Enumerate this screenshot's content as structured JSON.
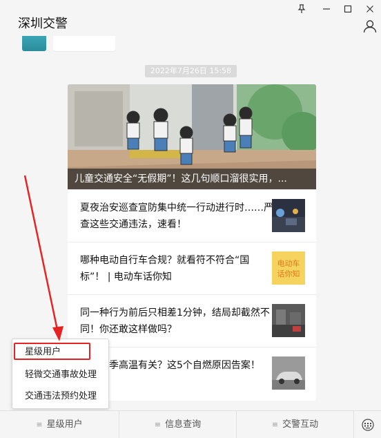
{
  "window": {
    "title": "深圳交警",
    "pin_icon": "pin-icon",
    "minimize_icon": "minimize-icon",
    "maximize_icon": "maximize-icon",
    "close_icon": "close-icon"
  },
  "header": {
    "user_icon": "user-icon"
  },
  "chat": {
    "timestamp": "2022年7月26日  15:58"
  },
  "article_card": {
    "hero_caption": "儿童交通安全“无假期”！这几句顺口溜很实用，...",
    "items": [
      {
        "text": "夏夜治安巡查宣防集中统一行动进行时……严查这些交通违法，速看！",
        "thumb": "night-patrol-photo"
      },
      {
        "text": "哪种电动自行车合规？就看符不符合“国标”！ | 电动车话你知",
        "thumb": "电动车话你知"
      },
      {
        "text": "同一种行为前后只相差1分钟，结局却截然不同！你还敢这样做吗？",
        "thumb": "traffic-photo"
      },
      {
        "text": "燃跟夏季高温有关？这5个自燃原因告案！",
        "thumb": "car-photo"
      }
    ]
  },
  "popup_menu": {
    "items": [
      {
        "label": "星级用户"
      },
      {
        "label": "轻微交通事故处理"
      },
      {
        "label": "交通违法预约处理"
      }
    ],
    "highlight_color": "#e62222"
  },
  "bottom_tabs": [
    {
      "label": "星级用户"
    },
    {
      "label": "信息查询"
    },
    {
      "label": "交警互动"
    }
  ],
  "keyboard_icon": "keyboard-icon",
  "colors": {
    "accent_red": "#e62222",
    "background": "#f5f5f5"
  }
}
